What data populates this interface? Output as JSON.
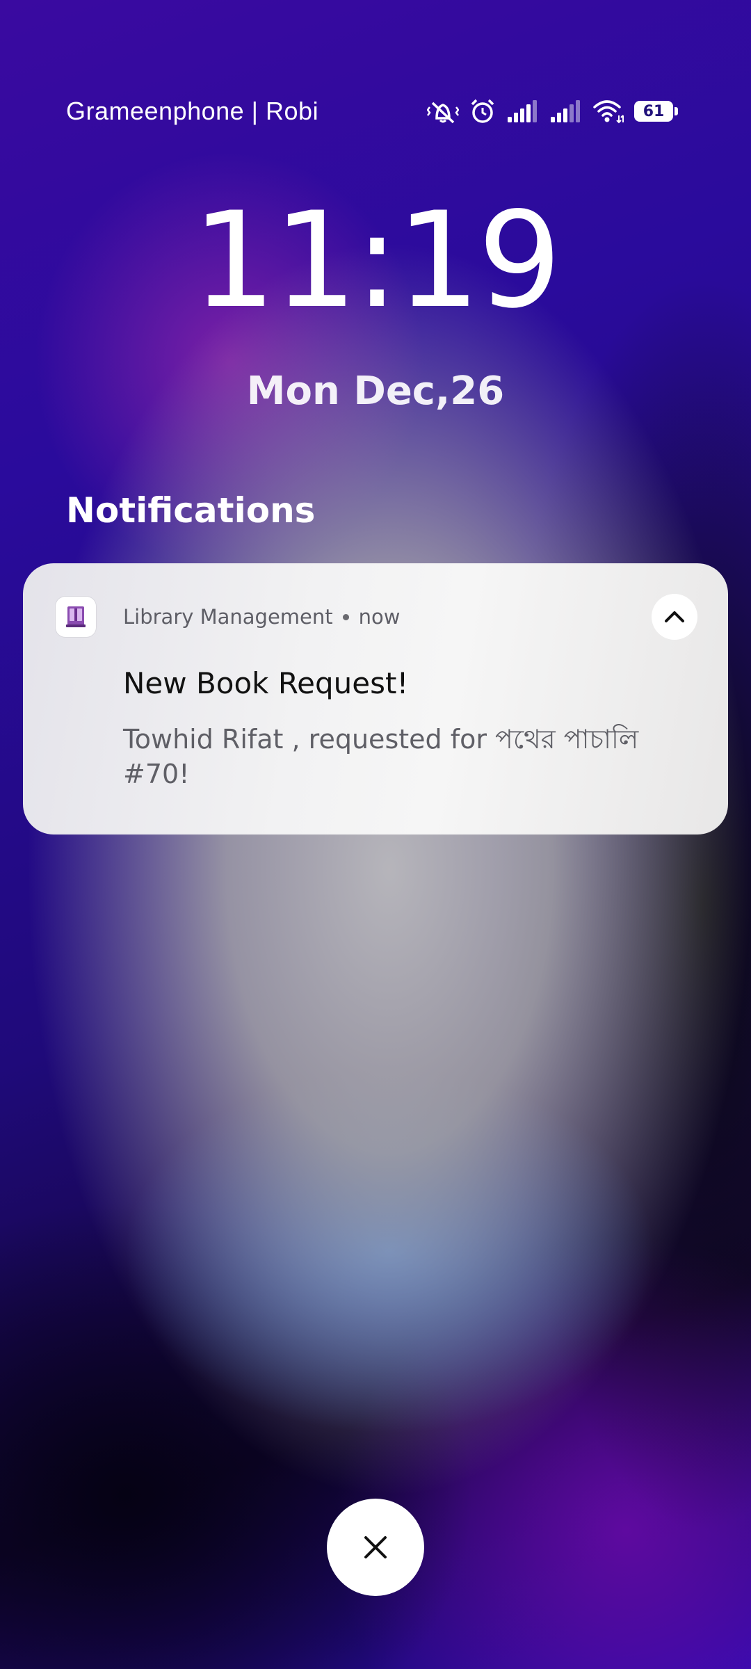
{
  "status_bar": {
    "carrier": "Grameenphone | Robi",
    "icons": [
      "vibrate-mute-icon",
      "alarm-icon",
      "signal-sim1-icon",
      "signal-sim2-icon",
      "wifi-icon",
      "battery-icon"
    ],
    "battery_percent": "61"
  },
  "lockscreen": {
    "time": "11:19",
    "date": "Mon Dec,26"
  },
  "notifications": {
    "heading": "Notifications",
    "items": [
      {
        "app_icon": "book-icon",
        "app_name": "Library Management",
        "time": "now",
        "title": "New Book Request!",
        "body": "Towhid Rifat , requested for পথের পাচালি #70!",
        "collapse_icon": "chevron-up-icon"
      }
    ]
  },
  "dismiss": {
    "icon": "close-icon"
  },
  "colors": {
    "background_top": "#2a0b9c",
    "background_bottom": "#120532",
    "card": "#f2f2f3",
    "battery_text": "#20107a"
  }
}
